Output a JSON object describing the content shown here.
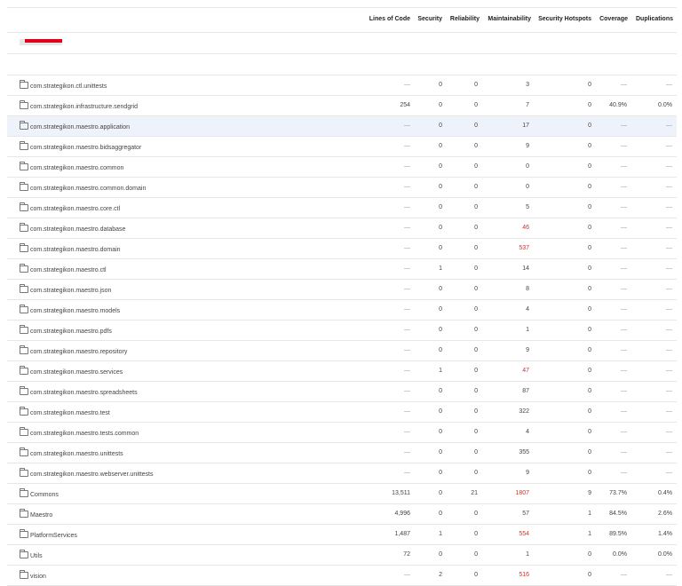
{
  "columns": {
    "loc": "Lines of Code",
    "security": "Security",
    "reliability": "Reliability",
    "maintainability": "Maintainability",
    "hotspots": "Security Hotspots",
    "coverage": "Coverage",
    "duplications": "Duplications"
  },
  "rows": [
    {
      "name": "com.strategikon.ctl.unittests",
      "loc": "—",
      "security": "0",
      "reliability": "0",
      "maintainability": "3",
      "hotspots": "0",
      "coverage": "—",
      "duplications": "—"
    },
    {
      "name": "com.strategikon.infrastructure.sendgrid",
      "loc": "254",
      "security": "0",
      "reliability": "0",
      "maintainability": "7",
      "hotspots": "0",
      "coverage": "40.9%",
      "duplications": "0.0%"
    },
    {
      "name": "com.strategikon.maestro.application",
      "loc": "—",
      "security": "0",
      "reliability": "0",
      "maintainability": "17",
      "hotspots": "0",
      "coverage": "—",
      "duplications": "—"
    },
    {
      "name": "com.strategikon.maestro.bidsaggregator",
      "loc": "—",
      "security": "0",
      "reliability": "0",
      "maintainability": "9",
      "hotspots": "0",
      "coverage": "—",
      "duplications": "—"
    },
    {
      "name": "com.strategikon.maestro.common",
      "loc": "—",
      "security": "0",
      "reliability": "0",
      "maintainability": "0",
      "hotspots": "0",
      "coverage": "—",
      "duplications": "—"
    },
    {
      "name": "com.strategikon.maestro.common.domain",
      "loc": "—",
      "security": "0",
      "reliability": "0",
      "maintainability": "0",
      "hotspots": "0",
      "coverage": "—",
      "duplications": "—"
    },
    {
      "name": "com.strategikon.maestro.core.ctl",
      "loc": "—",
      "security": "0",
      "reliability": "0",
      "maintainability": "5",
      "hotspots": "0",
      "coverage": "—",
      "duplications": "—"
    },
    {
      "name": "com.strategikon.maestro.database",
      "loc": "—",
      "security": "0",
      "reliability": "0",
      "maintainability": "46",
      "hotspots": "0",
      "coverage": "—",
      "duplications": "—"
    },
    {
      "name": "com.strategikon.maestro.domain",
      "loc": "—",
      "security": "0",
      "reliability": "0",
      "maintainability": "537",
      "hotspots": "0",
      "coverage": "—",
      "duplications": "—"
    },
    {
      "name": "com.strategikon.maestro.ctl",
      "loc": "—",
      "security": "1",
      "reliability": "0",
      "maintainability": "14",
      "hotspots": "0",
      "coverage": "—",
      "duplications": "—"
    },
    {
      "name": "com.strategikon.maestro.json",
      "loc": "—",
      "security": "0",
      "reliability": "0",
      "maintainability": "8",
      "hotspots": "0",
      "coverage": "—",
      "duplications": "—"
    },
    {
      "name": "com.strategikon.maestro.models",
      "loc": "—",
      "security": "0",
      "reliability": "0",
      "maintainability": "4",
      "hotspots": "0",
      "coverage": "—",
      "duplications": "—"
    },
    {
      "name": "com.strategikon.maestro.pdfs",
      "loc": "—",
      "security": "0",
      "reliability": "0",
      "maintainability": "1",
      "hotspots": "0",
      "coverage": "—",
      "duplications": "—"
    },
    {
      "name": "com.strategikon.maestro.repository",
      "loc": "—",
      "security": "0",
      "reliability": "0",
      "maintainability": "9",
      "hotspots": "0",
      "coverage": "—",
      "duplications": "—"
    },
    {
      "name": "com.strategikon.maestro.services",
      "loc": "—",
      "security": "1",
      "reliability": "0",
      "maintainability": "47",
      "hotspots": "0",
      "coverage": "—",
      "duplications": "—"
    },
    {
      "name": "com.strategikon.maestro.spreadsheets",
      "loc": "—",
      "security": "0",
      "reliability": "0",
      "maintainability": "87",
      "hotspots": "0",
      "coverage": "—",
      "duplications": "—"
    },
    {
      "name": "com.strategikon.maestro.test",
      "loc": "—",
      "security": "0",
      "reliability": "0",
      "maintainability": "322",
      "hotspots": "0",
      "coverage": "—",
      "duplications": "—"
    },
    {
      "name": "com.strategikon.maestro.tests.common",
      "loc": "—",
      "security": "0",
      "reliability": "0",
      "maintainability": "4",
      "hotspots": "0",
      "coverage": "—",
      "duplications": "—"
    },
    {
      "name": "com.strategikon.maestro.unittests",
      "loc": "—",
      "security": "0",
      "reliability": "0",
      "maintainability": "355",
      "hotspots": "0",
      "coverage": "—",
      "duplications": "—"
    },
    {
      "name": "com.strategikon.maestro.webserver.unittests",
      "loc": "—",
      "security": "0",
      "reliability": "0",
      "maintainability": "9",
      "hotspots": "0",
      "coverage": "—",
      "duplications": "—"
    },
    {
      "name": "Commons",
      "loc": "13,511",
      "security": "0",
      "reliability": "21",
      "maintainability": "1807",
      "hotspots": "9",
      "coverage": "73.7%",
      "duplications": "0.4%"
    },
    {
      "name": "Maestro",
      "loc": "4,996",
      "security": "0",
      "reliability": "0",
      "maintainability": "57",
      "hotspots": "1",
      "coverage": "84.5%",
      "duplications": "2.6%"
    },
    {
      "name": "PlatformServices",
      "loc": "1,487",
      "security": "1",
      "reliability": "0",
      "maintainability": "554",
      "hotspots": "1",
      "coverage": "89.5%",
      "duplications": "1.4%"
    },
    {
      "name": "Utils",
      "loc": "72",
      "security": "0",
      "reliability": "0",
      "maintainability": "1",
      "hotspots": "0",
      "coverage": "0.0%",
      "duplications": "0.0%"
    },
    {
      "name": "vision",
      "loc": "—",
      "security": "2",
      "reliability": "0",
      "maintainability": "516",
      "hotspots": "0",
      "coverage": "—",
      "duplications": "—"
    }
  ],
  "colors": {
    "border": "#e6e6e6",
    "selected_row": "#eef2fb",
    "redaction": "#e0001a"
  }
}
